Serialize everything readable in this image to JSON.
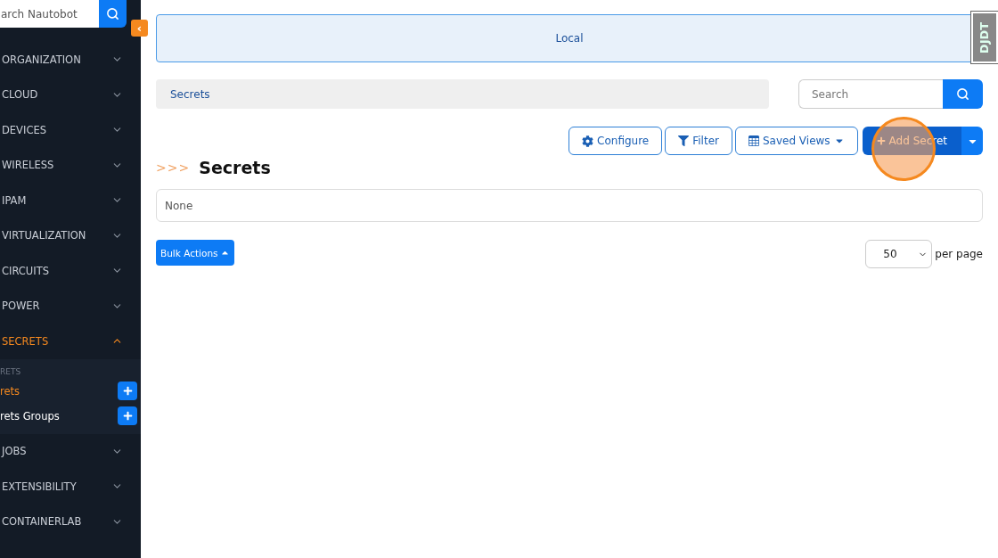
{
  "sidebar": {
    "search": {
      "placeholder": "arch Nautobot"
    },
    "collapse_button": "‹",
    "sections": [
      {
        "label": "ORGANIZATION",
        "expanded": false
      },
      {
        "label": "CLOUD",
        "expanded": false
      },
      {
        "label": "DEVICES",
        "expanded": false
      },
      {
        "label": "WIRELESS",
        "expanded": false
      },
      {
        "label": "IPAM",
        "expanded": false
      },
      {
        "label": "VIRTUALIZATION",
        "expanded": false
      },
      {
        "label": "CIRCUITS",
        "expanded": false
      },
      {
        "label": "POWER",
        "expanded": false
      },
      {
        "label": "SECRETS",
        "expanded": true,
        "heading": "RETS",
        "items": [
          {
            "label": "rets",
            "selected": true
          },
          {
            "label": "rets Groups",
            "selected": false
          }
        ]
      },
      {
        "label": "JOBS",
        "expanded": false
      },
      {
        "label": "EXTENSIBILITY",
        "expanded": false
      },
      {
        "label": "CONTAINERLAB",
        "expanded": false
      }
    ]
  },
  "banner": "Local",
  "breadcrumb": "Secrets",
  "search": {
    "placeholder": "Search"
  },
  "toolbar": [
    {
      "kind": "configure",
      "label": "Configure"
    },
    {
      "kind": "filter",
      "label": "Filter"
    },
    {
      "kind": "saved_views",
      "label": "Saved Views"
    }
  ],
  "add_button": "Add Secret",
  "title_prefix": ">>>",
  "title": "Secrets",
  "filter_summary": "None",
  "bulk_actions": "Bulk Actions",
  "per_page": {
    "value": "50",
    "label": "per page"
  },
  "debug_toolbar": "DJDT"
}
